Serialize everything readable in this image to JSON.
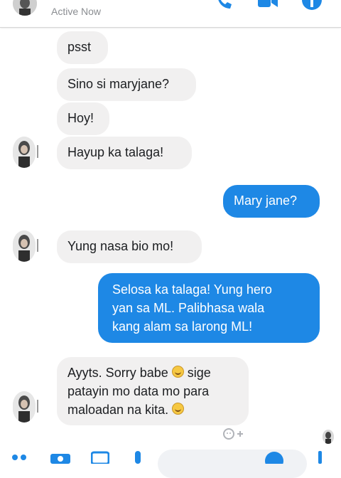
{
  "header": {
    "status": "Active Now",
    "icons": [
      "avatar",
      "phone-icon",
      "video-icon",
      "info-icon"
    ]
  },
  "messages": [
    {
      "side": "in",
      "text": "psst"
    },
    {
      "side": "in",
      "text": "Sino si maryjane?"
    },
    {
      "side": "in",
      "text": "Hoy!"
    },
    {
      "side": "in",
      "text": "Hayup ka talaga!"
    },
    {
      "side": "out",
      "text": "Mary jane?"
    },
    {
      "side": "in",
      "text": "Yung nasa bio mo!"
    },
    {
      "side": "out",
      "lines": [
        "Selosa ka talaga! Yung hero",
        "yan sa ML. Palibhasa wala",
        "kang alam sa larong ML!"
      ]
    },
    {
      "side": "in",
      "lines": [
        "Ayyts. Sorry babe",
        "sige",
        "patayin mo data mo para",
        "maloadan na kita."
      ],
      "emoji": "grinning-face"
    }
  ],
  "colors": {
    "outgoing_bubble": "#1e88e5",
    "incoming_bubble": "#f1f0f0",
    "accent": "#1e88e5"
  },
  "bottom_bar": {
    "icons": [
      "menu-dots-icon",
      "camera-icon",
      "gallery-icon",
      "mic-icon",
      "emoji-icon",
      "like-icon"
    ]
  }
}
